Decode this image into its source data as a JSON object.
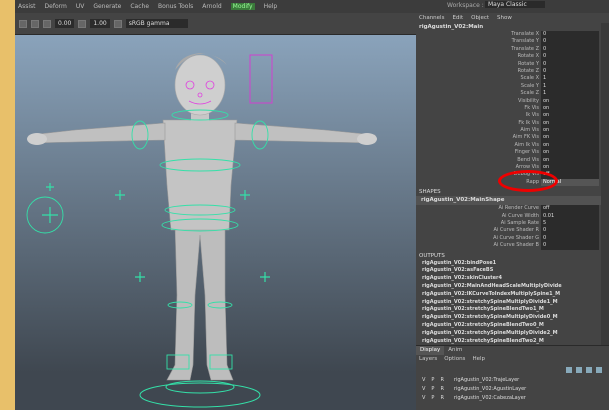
{
  "topbar": {
    "menus": [
      "Assist",
      "Deform",
      "UV",
      "Generate",
      "Cache",
      "Bonus Tools",
      "Arnold",
      "Modify",
      "Help"
    ],
    "workspace_label": "Workspace :",
    "workspace_value": "Maya Classic"
  },
  "viewport_toolbar": {
    "value_a": "0.00",
    "value_b": "1.00",
    "color_space": "sRGB gamma"
  },
  "channel_box": {
    "menus": [
      "Channels",
      "Edit",
      "Object",
      "Show"
    ],
    "node_name": "rigAgustin_V02:Main",
    "attributes": [
      {
        "label": "Translate X",
        "value": "0"
      },
      {
        "label": "Translate Y",
        "value": "0"
      },
      {
        "label": "Translate Z",
        "value": "0"
      },
      {
        "label": "Rotate X",
        "value": "0"
      },
      {
        "label": "Rotate Y",
        "value": "0"
      },
      {
        "label": "Rotate Z",
        "value": "0"
      },
      {
        "label": "Scale X",
        "value": "1"
      },
      {
        "label": "Scale Y",
        "value": "1"
      },
      {
        "label": "Scale Z",
        "value": "1"
      },
      {
        "label": "Visibility",
        "value": "on"
      },
      {
        "label": "Fk Vis",
        "value": "on"
      },
      {
        "label": "Ik Vis",
        "value": "on"
      },
      {
        "label": "Fk Ik Vis",
        "value": "on"
      },
      {
        "label": "Aim Vis",
        "value": "on"
      },
      {
        "label": "Aim FK Vis",
        "value": "on"
      },
      {
        "label": "Aim Ik Vis",
        "value": "on"
      },
      {
        "label": "Finger Vis",
        "value": "on"
      },
      {
        "label": "Bend Vis",
        "value": "on"
      },
      {
        "label": "Arrow Vis",
        "value": "on"
      },
      {
        "label": "Debug Vis",
        "value": "off"
      },
      {
        "label": "Rapp",
        "value": "Normal"
      }
    ],
    "shapes_header": "SHAPES",
    "shape_node": "rigAgustin_V02:MainShape",
    "shape_attributes": [
      {
        "label": "Ai Render Curve",
        "value": "off"
      },
      {
        "label": "Ai Curve Width",
        "value": "0.01"
      },
      {
        "label": "Ai Sample Rate",
        "value": "5"
      },
      {
        "label": "Ai Curve Shader R",
        "value": "0"
      },
      {
        "label": "Ai Curve Shader G",
        "value": "0"
      },
      {
        "label": "Ai Curve Shader B",
        "value": "0"
      }
    ],
    "outputs_header": "OUTPUTS",
    "outputs": [
      "rigAgustin_V02:bindPose1",
      "rigAgustin_V02:asFaceBS",
      "rigAgustin_V02:skinCluster4",
      "rigAgustin_V02:MainAndHeadScaleMultiplyDivide",
      "rigAgustin_V02:IKCurveToIndexMultiplySpine1_M",
      "rigAgustin_V02:stretchySpineMultiplyDivide1_M",
      "rigAgustin_V02:stretchySpineBlendTwo1_M",
      "rigAgustin_V02:stretchySpineMultiplyDivide0_M",
      "rigAgustin_V02:stretchySpineBlendTwo0_M",
      "rigAgustin_V02:stretchySpineMultiplyDivide2_M",
      "rigAgustin_V02:stretchySpineBlendTwo2_M"
    ]
  },
  "layer_editor": {
    "tabs": [
      "Display",
      "Anim"
    ],
    "menus": [
      "Layers",
      "Options",
      "Help"
    ],
    "layers": [
      {
        "v": "V",
        "p": "P",
        "r": "R",
        "name": "rigAgustin_V02:TrajeLayer"
      },
      {
        "v": "V",
        "p": "P",
        "r": "R",
        "name": "rigAgustin_V02:AgustinLayer"
      },
      {
        "v": "V",
        "p": "P",
        "r": "R",
        "name": "rigAgustin_V02:CabezaLayer"
      }
    ]
  }
}
